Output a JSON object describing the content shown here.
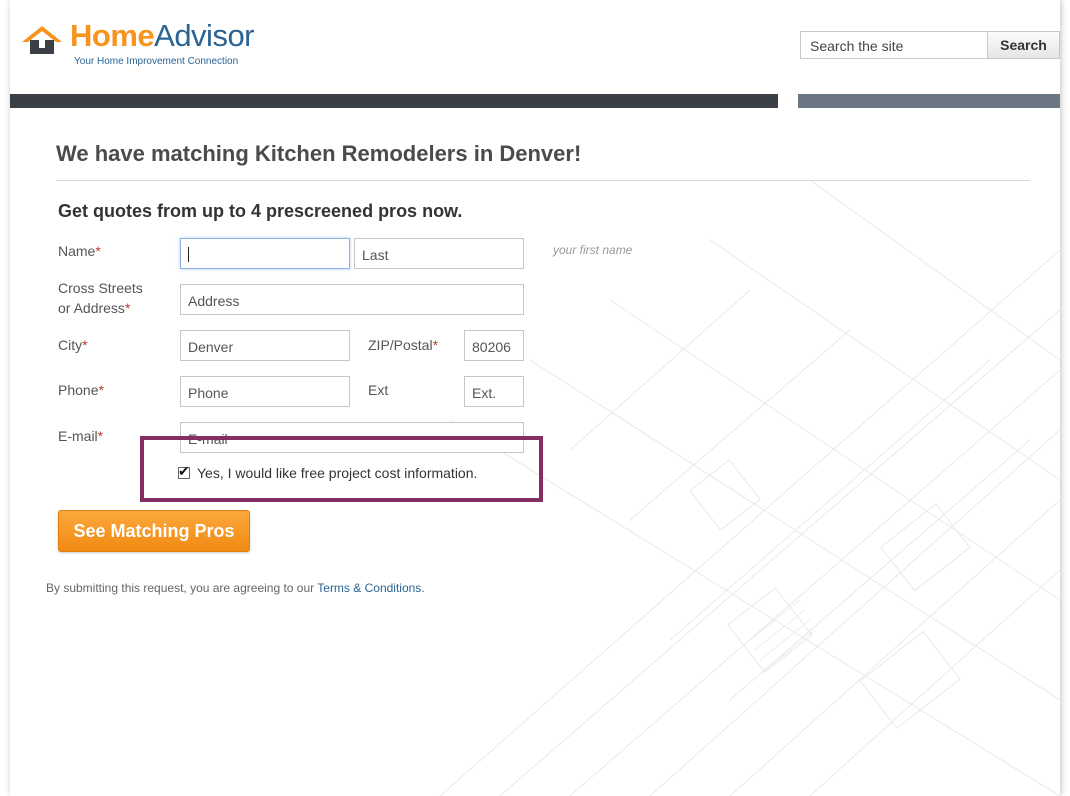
{
  "header": {
    "logo_home": "Home",
    "logo_advisor": "Advisor",
    "tagline": "Your Home Improvement Connection",
    "search_value": "Search the site",
    "search_button": "Search"
  },
  "main": {
    "heading": "We have matching Kitchen Remodelers in Denver!",
    "subheading": "Get quotes from up to 4 prescreened pros now."
  },
  "form": {
    "name_label": "Name",
    "first_name_value": "",
    "last_name_value": "Last",
    "first_name_hint": "your first name",
    "address_label_line1": "Cross Streets",
    "address_label_line2": "or Address",
    "address_value": "Address",
    "city_label": "City",
    "city_value": "Denver",
    "zip_label": "ZIP/Postal",
    "zip_value": "80206",
    "phone_label": "Phone",
    "phone_value": "Phone",
    "ext_label": "Ext",
    "ext_value": "Ext.",
    "email_label": "E-mail",
    "email_value": "E-mail",
    "required_marker": "*",
    "cost_info_checkbox_label": "Yes, I would like free project cost information.",
    "cost_info_checked": true,
    "submit_label": "See Matching Pros"
  },
  "legal": {
    "text": "By submitting this request, you are agreeing to our ",
    "link": "Terms & Conditions",
    "end": "."
  },
  "colors": {
    "brand_orange": "#f7941e",
    "brand_blue": "#2a6496",
    "highlight_box": "#842e62",
    "required_star": "#c0392b"
  }
}
